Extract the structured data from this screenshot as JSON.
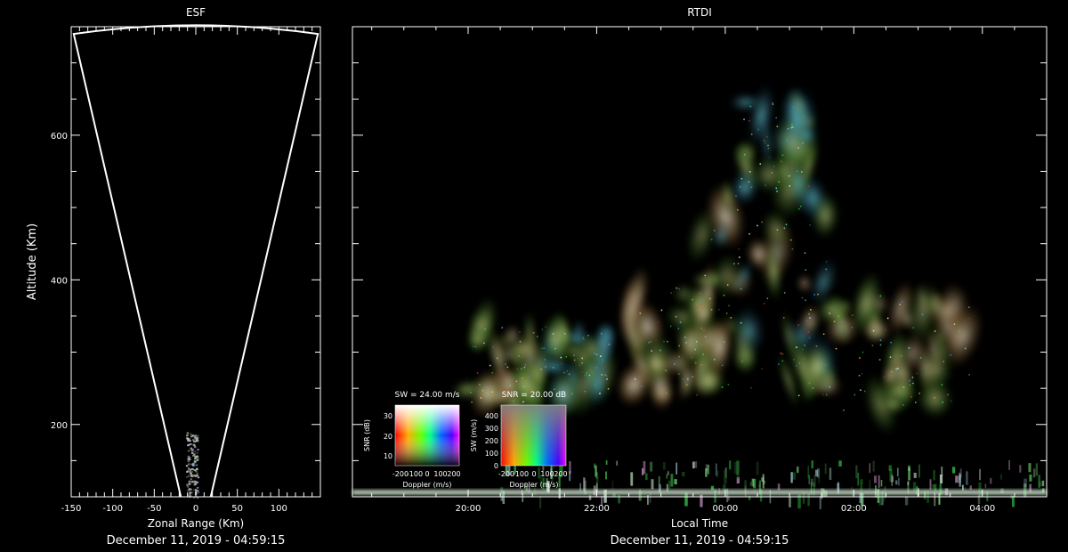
{
  "esf": {
    "title": "ESF",
    "xlabel": "Zonal Range (Km)",
    "ylabel": "Altitude (Km)",
    "date": "December 11, 2019 - 04:59:15"
  },
  "rtdi": {
    "title": "RTDI",
    "xlabel": "Local Time",
    "date": "December 11, 2019 - 04:59:15"
  },
  "legend_sw": {
    "title": "SW = 24.00 m/s",
    "ylabel": "SNR (dB)",
    "xlabel": "Doppler (m/s)",
    "yticks": [
      "30",
      "20",
      "10"
    ],
    "xticks": [
      "-200",
      "-100",
      "0",
      "100",
      "200"
    ]
  },
  "legend_snr": {
    "title": "SNR = 20.00 dB",
    "ylabel": "SW (m/s)",
    "xlabel": "Doppler (m/s)",
    "yticks": [
      "400",
      "300",
      "200",
      "100",
      "0"
    ],
    "xticks": [
      "-200",
      "-100",
      "0",
      "100",
      "200"
    ]
  },
  "chart_data": [
    {
      "type": "heatmap",
      "title": "ESF",
      "xlabel": "Zonal Range (Km)",
      "ylabel": "Altitude (Km)",
      "xlim": [
        -150,
        150
      ],
      "ylim": [
        100,
        750
      ],
      "x_ticks": [
        -150,
        -100,
        -50,
        0,
        50,
        100
      ],
      "y_ticks": [
        200,
        400,
        600
      ],
      "fan_outline": {
        "apex_altitude": 100,
        "half_angle_deg": 11,
        "top_altitude": 750
      },
      "echo": {
        "x_center": -5,
        "altitude_range": [
          100,
          190
        ]
      }
    },
    {
      "type": "heatmap",
      "title": "RTDI",
      "xlabel": "Local Time",
      "ylabel": "Altitude (Km)",
      "xlim_hours": [
        18.2,
        29.0
      ],
      "ylim": [
        100,
        750
      ],
      "x_ticks": [
        "20:00",
        "22:00",
        "00:00",
        "02:00",
        "04:00"
      ],
      "x_tick_hours": [
        20,
        22,
        24,
        26,
        28
      ],
      "y_ticks": [
        200,
        400,
        600
      ],
      "color_key": "RGB: Doppler (m/s) / SNR (dB) / SW (m/s)",
      "echo_regions": [
        {
          "hours": [
            20.0,
            21.2
          ],
          "altitude": [
            230,
            340
          ]
        },
        {
          "hours": [
            21.3,
            22.2
          ],
          "altitude": [
            240,
            330
          ]
        },
        {
          "hours": [
            22.5,
            23.8
          ],
          "altitude": [
            240,
            390
          ]
        },
        {
          "hours": [
            23.6,
            25.6
          ],
          "altitude": [
            240,
            520
          ]
        },
        {
          "hours": [
            24.2,
            25.3
          ],
          "altitude": [
            520,
            650
          ]
        },
        {
          "hours": [
            25.0,
            27.8
          ],
          "altitude": [
            220,
            380
          ]
        },
        {
          "hours": [
            20.5,
            29.0
          ],
          "altitude": [
            100,
            200
          ]
        }
      ]
    }
  ]
}
